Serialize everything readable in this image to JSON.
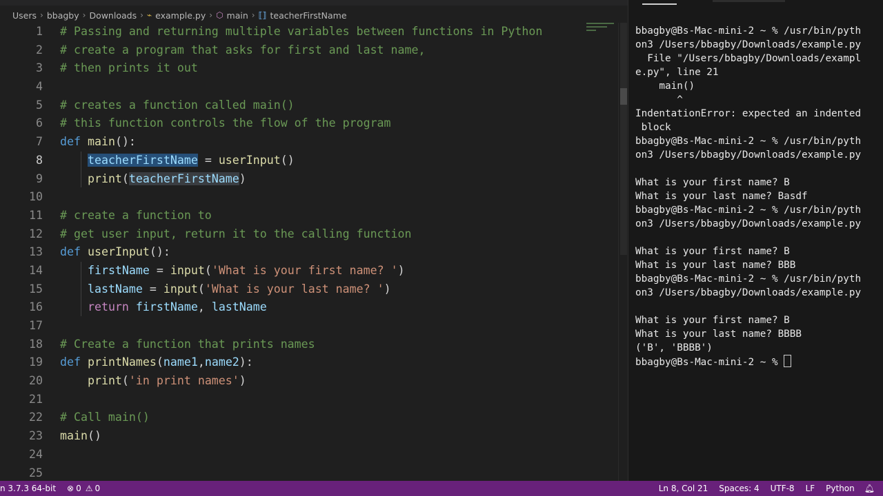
{
  "breadcrumb": {
    "items": [
      {
        "label": "Users",
        "icon": ""
      },
      {
        "label": "bbagby",
        "icon": ""
      },
      {
        "label": "Downloads",
        "icon": ""
      },
      {
        "label": "example.py",
        "icon": "python-file-icon"
      },
      {
        "label": "main",
        "icon": "function-icon"
      },
      {
        "label": "teacherFirstName",
        "icon": "variable-icon"
      }
    ]
  },
  "editor": {
    "current_line": 8,
    "lines": [
      {
        "n": "1",
        "tokens": [
          {
            "t": "# Passing and returning multiple variables between functions in Python",
            "c": "c"
          }
        ]
      },
      {
        "n": "2",
        "tokens": [
          {
            "t": "# create a program that asks for first and last name,",
            "c": "c"
          }
        ]
      },
      {
        "n": "3",
        "tokens": [
          {
            "t": "# then prints it out",
            "c": "c"
          }
        ]
      },
      {
        "n": "4",
        "tokens": []
      },
      {
        "n": "5",
        "tokens": [
          {
            "t": "# creates a function called main()",
            "c": "c"
          }
        ]
      },
      {
        "n": "6",
        "tokens": [
          {
            "t": "# this function controls the flow of the program",
            "c": "c"
          }
        ]
      },
      {
        "n": "7",
        "tokens": [
          {
            "t": "def",
            "c": "k"
          },
          {
            "t": " ",
            "c": "p"
          },
          {
            "t": "main",
            "c": "f"
          },
          {
            "t": "():",
            "c": "p"
          }
        ]
      },
      {
        "n": "8",
        "tokens": [
          {
            "t": "    ",
            "c": "p"
          },
          {
            "t": "teacherFirstName",
            "c": "v hl"
          },
          {
            "t": " = ",
            "c": "p"
          },
          {
            "t": "userInput",
            "c": "f"
          },
          {
            "t": "()",
            "c": "p"
          }
        ]
      },
      {
        "n": "9",
        "tokens": [
          {
            "t": "    ",
            "c": "p"
          },
          {
            "t": "print",
            "c": "f"
          },
          {
            "t": "(",
            "c": "p"
          },
          {
            "t": "teacherFirstName",
            "c": "v hl2"
          },
          {
            "t": ")",
            "c": "p"
          }
        ]
      },
      {
        "n": "10",
        "tokens": []
      },
      {
        "n": "11",
        "tokens": [
          {
            "t": "# create a function to",
            "c": "c"
          }
        ]
      },
      {
        "n": "12",
        "tokens": [
          {
            "t": "# get user input, return it to the calling function",
            "c": "c"
          }
        ]
      },
      {
        "n": "13",
        "tokens": [
          {
            "t": "def",
            "c": "k"
          },
          {
            "t": " ",
            "c": "p"
          },
          {
            "t": "userInput",
            "c": "f"
          },
          {
            "t": "():",
            "c": "p"
          }
        ]
      },
      {
        "n": "14",
        "tokens": [
          {
            "t": "    ",
            "c": "p"
          },
          {
            "t": "firstName",
            "c": "v"
          },
          {
            "t": " = ",
            "c": "p"
          },
          {
            "t": "input",
            "c": "f"
          },
          {
            "t": "(",
            "c": "p"
          },
          {
            "t": "'What is your first name? '",
            "c": "s"
          },
          {
            "t": ")",
            "c": "p"
          }
        ]
      },
      {
        "n": "15",
        "tokens": [
          {
            "t": "    ",
            "c": "p"
          },
          {
            "t": "lastName",
            "c": "v"
          },
          {
            "t": " = ",
            "c": "p"
          },
          {
            "t": "input",
            "c": "f"
          },
          {
            "t": "(",
            "c": "p"
          },
          {
            "t": "'What is your last name? '",
            "c": "s"
          },
          {
            "t": ")",
            "c": "p"
          }
        ]
      },
      {
        "n": "16",
        "tokens": [
          {
            "t": "    ",
            "c": "p"
          },
          {
            "t": "return",
            "c": "kr"
          },
          {
            "t": " ",
            "c": "p"
          },
          {
            "t": "firstName",
            "c": "v"
          },
          {
            "t": ", ",
            "c": "p"
          },
          {
            "t": "lastName",
            "c": "v"
          }
        ]
      },
      {
        "n": "17",
        "tokens": []
      },
      {
        "n": "18",
        "tokens": [
          {
            "t": "# Create a function that prints names",
            "c": "c"
          }
        ]
      },
      {
        "n": "19",
        "tokens": [
          {
            "t": "def",
            "c": "k"
          },
          {
            "t": " ",
            "c": "p"
          },
          {
            "t": "printNames",
            "c": "f"
          },
          {
            "t": "(",
            "c": "p"
          },
          {
            "t": "name1",
            "c": "v"
          },
          {
            "t": ",",
            "c": "p"
          },
          {
            "t": "name2",
            "c": "v"
          },
          {
            "t": "):",
            "c": "p"
          }
        ]
      },
      {
        "n": "20",
        "tokens": [
          {
            "t": "    ",
            "c": "p"
          },
          {
            "t": "print",
            "c": "f"
          },
          {
            "t": "(",
            "c": "p"
          },
          {
            "t": "'in print names'",
            "c": "s"
          },
          {
            "t": ")",
            "c": "p"
          }
        ]
      },
      {
        "n": "21",
        "tokens": []
      },
      {
        "n": "22",
        "tokens": [
          {
            "t": "# Call main()",
            "c": "c"
          }
        ]
      },
      {
        "n": "23",
        "tokens": [
          {
            "t": "main",
            "c": "f"
          },
          {
            "t": "()",
            "c": "p"
          }
        ]
      },
      {
        "n": "24",
        "tokens": []
      },
      {
        "n": "25",
        "tokens": []
      }
    ]
  },
  "terminal": {
    "lines": [
      "bbagby@Bs-Mac-mini-2 ~ % /usr/bin/pyth",
      "on3 /Users/bbagby/Downloads/example.py",
      "  File \"/Users/bbagby/Downloads/exampl",
      "e.py\", line 21",
      "    main()",
      "       ^",
      "IndentationError: expected an indented",
      " block",
      "bbagby@Bs-Mac-mini-2 ~ % /usr/bin/pyth",
      "on3 /Users/bbagby/Downloads/example.py",
      "",
      "What is your first name? B",
      "What is your last name? Basdf",
      "bbagby@Bs-Mac-mini-2 ~ % /usr/bin/pyth",
      "on3 /Users/bbagby/Downloads/example.py",
      "",
      "What is your first name? B",
      "What is your last name? BBB",
      "bbagby@Bs-Mac-mini-2 ~ % /usr/bin/pyth",
      "on3 /Users/bbagby/Downloads/example.py",
      "",
      "What is your first name? B",
      "What is your last name? BBBB",
      "('B', 'BBBB')"
    ],
    "prompt": "bbagby@Bs-Mac-mini-2 ~ % "
  },
  "statusbar": {
    "interpreter": "n 3.7.3 64-bit",
    "errors": "0",
    "warnings": "0",
    "position": "Ln 8, Col 21",
    "spaces": "Spaces: 4",
    "encoding": "UTF-8",
    "eol": "LF",
    "language": "Python"
  },
  "colors": {
    "statusbar": "#68217a",
    "comment": "#6a9955",
    "keyword": "#569cd6",
    "function": "#dcdcaa",
    "string": "#ce9178",
    "variable": "#9cdcfe"
  }
}
